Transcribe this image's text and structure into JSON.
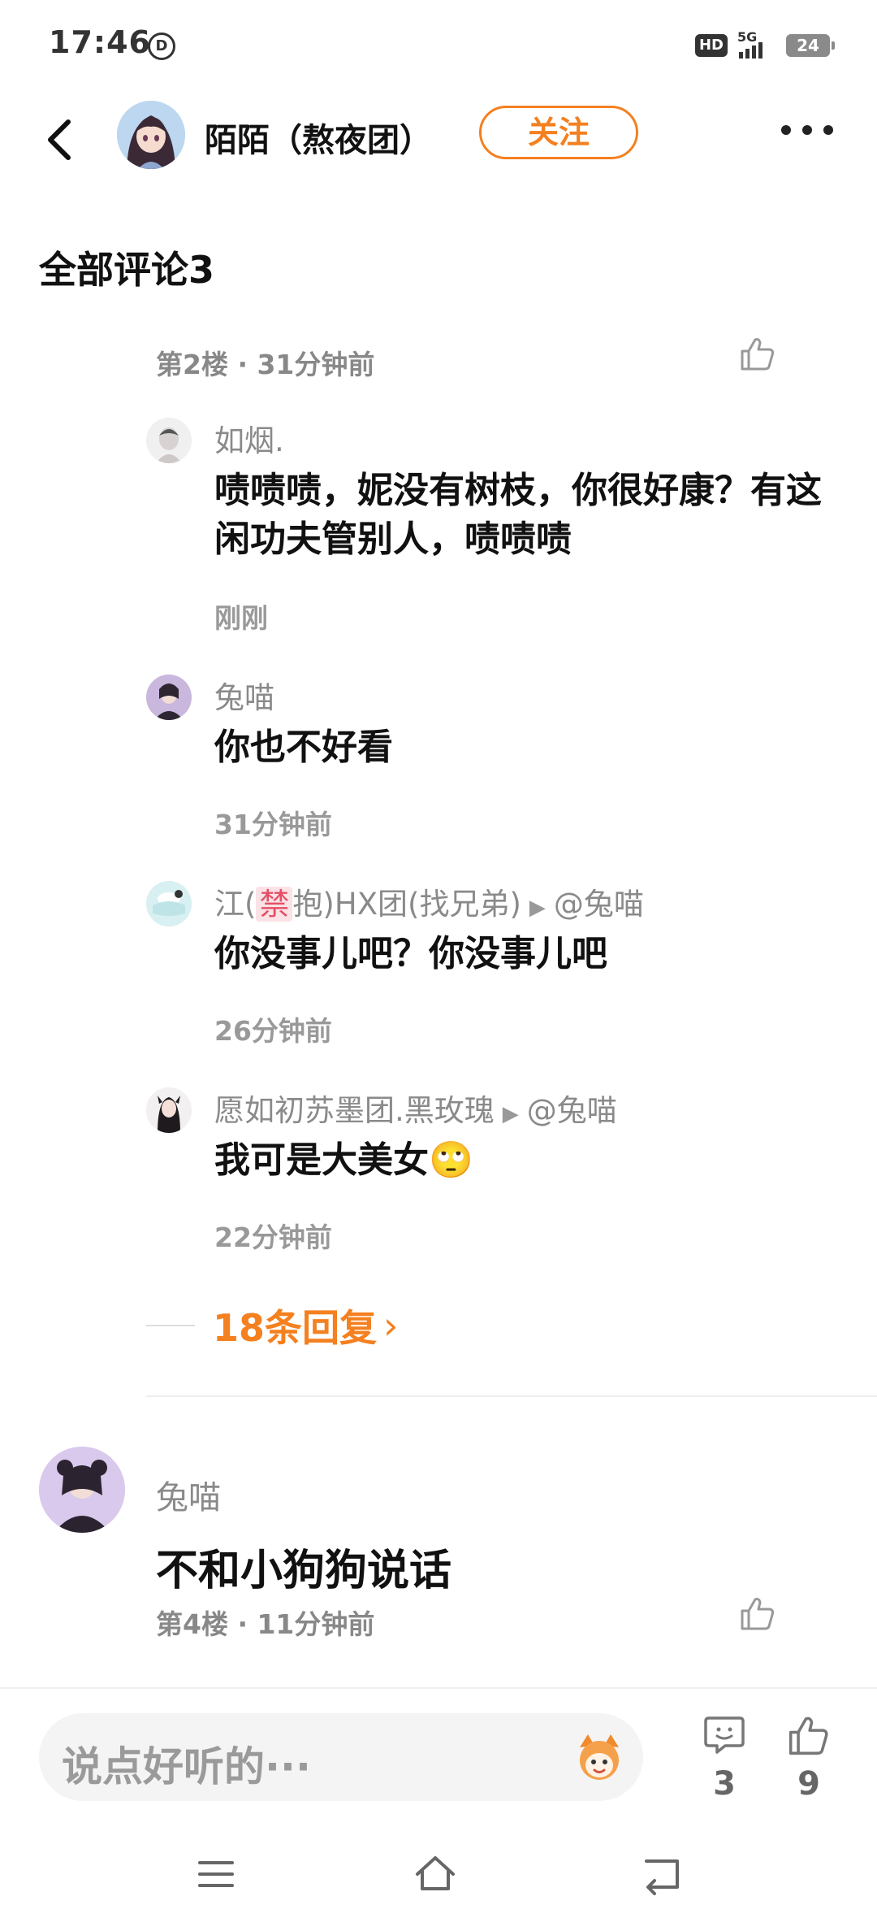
{
  "status_bar": {
    "time": "17:46",
    "dnd_glyph": "D",
    "hd_label": "HD",
    "network": "5G",
    "battery": "24"
  },
  "header": {
    "username": "陌陌（熬夜团）",
    "follow_label": "关注"
  },
  "section_title": "全部评论3",
  "thread": {
    "floor_meta": "第2楼 · 31分钟前",
    "replies": [
      {
        "name": "如烟.",
        "text": "啧啧啧，妮没有树枝，你很好康？有这闲功夫管别人，啧啧啧",
        "time": "刚刚"
      },
      {
        "name": "兔喵",
        "text": "你也不好看",
        "time": "31分钟前"
      },
      {
        "name_prefix": "江(",
        "name_badge": "禁",
        "name_suffix": "抱)HX团(找兄弟)",
        "reply_to": "@兔喵",
        "text": "你没事儿吧？你没事儿吧",
        "time": "26分钟前"
      },
      {
        "name": "愿如初苏墨团.黑玫瑰",
        "reply_to": "@兔喵",
        "text": "我可是大美女🙄",
        "time": "22分钟前"
      }
    ],
    "more_replies": "18条回复",
    "more_replies_arrow": "›"
  },
  "comment": {
    "name": "兔喵",
    "text": "不和小狗狗说话",
    "floor_meta": "第4楼 · 11分钟前"
  },
  "bottom_bar": {
    "input_placeholder": "说点好听的···",
    "comment_count": "3",
    "like_count": "9"
  },
  "colors": {
    "accent": "#f4801f",
    "muted_text": "#8a8a8a",
    "primary_text": "#111111"
  }
}
